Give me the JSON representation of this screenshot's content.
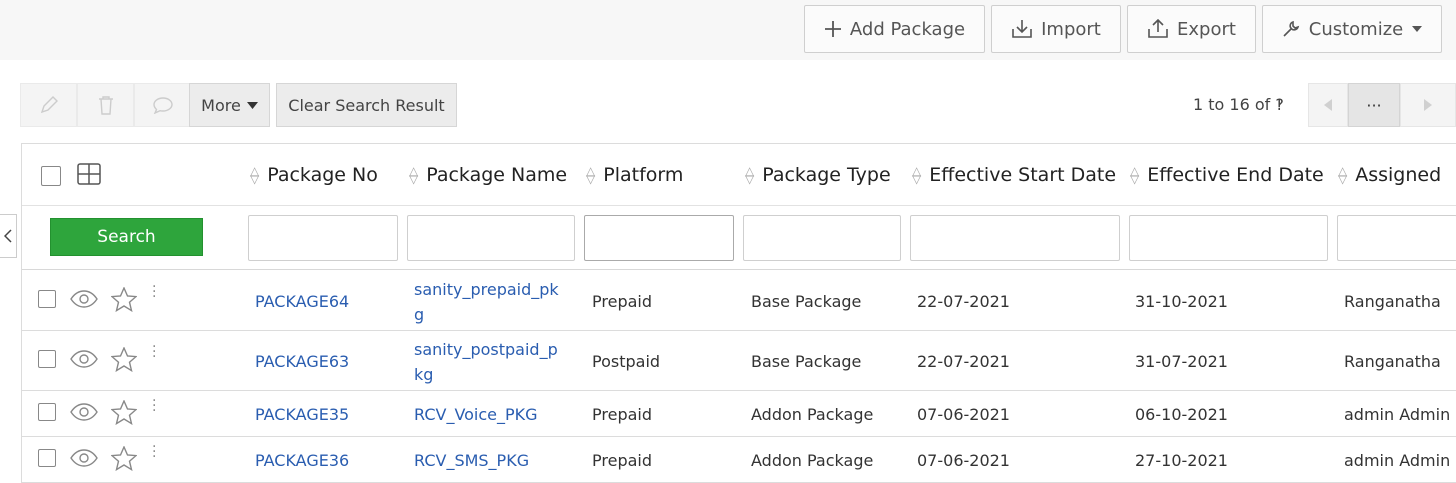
{
  "topbar": {
    "add_package": "Add Package",
    "import": "Import",
    "export": "Export",
    "customize": "Customize"
  },
  "toolbar": {
    "more": "More",
    "clear_search": "Clear Search Result",
    "pager_text": "1 to 16  of",
    "pager_more": "···"
  },
  "filters": {
    "search_button": "Search"
  },
  "columns": [
    "Package No",
    "Package Name",
    "Platform",
    "Package Type",
    "Effective Start Date",
    "Effective End Date",
    "Assigned"
  ],
  "rows": [
    {
      "package_no": "PACKAGE64",
      "package_name": "sanity_prepaid_pkg",
      "platform": "Prepaid",
      "package_type": "Base Package",
      "start": "22-07-2021",
      "end": "31-10-2021",
      "assigned": "Ranganatha"
    },
    {
      "package_no": "PACKAGE63",
      "package_name": "sanity_postpaid_pkg",
      "platform": "Postpaid",
      "package_type": "Base Package",
      "start": "22-07-2021",
      "end": "31-07-2021",
      "assigned": "Ranganatha"
    },
    {
      "package_no": "PACKAGE35",
      "package_name": "RCV_Voice_PKG",
      "platform": "Prepaid",
      "package_type": "Addon Package",
      "start": "07-06-2021",
      "end": "06-10-2021",
      "assigned": "admin Admin"
    },
    {
      "package_no": "PACKAGE36",
      "package_name": "RCV_SMS_PKG",
      "platform": "Prepaid",
      "package_type": "Addon Package",
      "start": "07-06-2021",
      "end": "27-10-2021",
      "assigned": "admin Admin"
    }
  ]
}
